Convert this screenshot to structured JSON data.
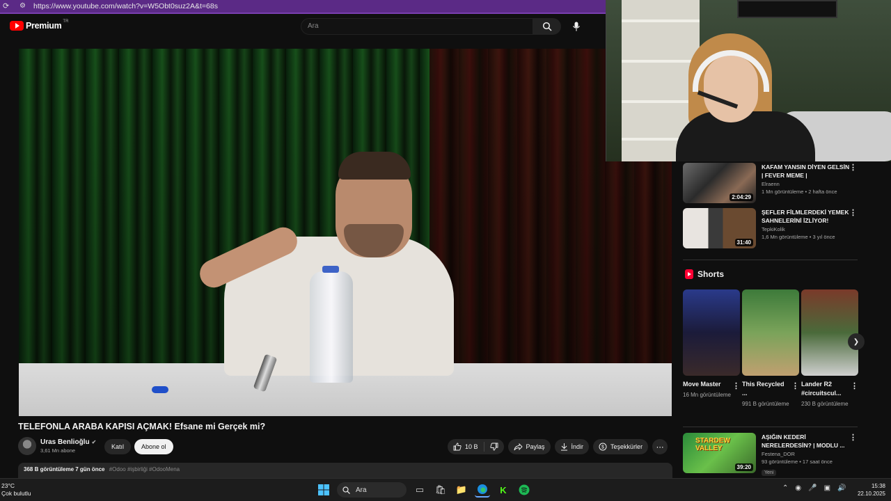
{
  "browser": {
    "url": "https://www.youtube.com/watch?v=W5Obt0suz2A&t=68s"
  },
  "header": {
    "logo_text": "Premium",
    "logo_region": "TR",
    "search_placeholder": "Ara"
  },
  "video": {
    "title": "TELEFONLA ARABA KAPISI AÇMAK! Efsane mi Gerçek mi?",
    "channel_name": "Uras Benlioğlu",
    "subscribers": "3,61 Mn abone",
    "join_label": "Katıl",
    "subscribe_label": "Abone ol",
    "likes": "10 B",
    "share_label": "Paylaş",
    "download_label": "İndir",
    "thanks_label": "Teşekkürler",
    "views": "368 B görüntüleme",
    "age": "7 gün önce",
    "tags": "#Odoo #işbirliği #OdooMena"
  },
  "recommendations": [
    {
      "title": "KAFAM YANSIN DİYEN GELSİN | FEVER MEME |",
      "channel": "Elraenn",
      "meta": "1 Mn görüntüleme • 2 hafta önce",
      "duration": "2:04:29"
    },
    {
      "title": "ŞEFLER FİLMLERDEKİ YEMEK SAHNELERİNİ İZLİYOR!",
      "channel": "TepkiKolik",
      "meta": "1,6 Mn görüntüleme • 3 yıl önce",
      "duration": "31:40"
    }
  ],
  "shorts": {
    "heading": "Shorts",
    "items": [
      {
        "title": "Move Master",
        "views": "16 Mn görüntüleme"
      },
      {
        "title": "This Recycled ...",
        "views": "991 B görüntüleme"
      },
      {
        "title": "Lander R2 #circuitscul...",
        "views": "230 B görüntüleme"
      }
    ]
  },
  "rec_bottom": {
    "title": "AŞIĞIN KEDERİ NERELERDESİN? | MODLU ...",
    "channel": "Festena_DOR",
    "meta": "93 görüntüleme • 17 saat önce",
    "duration": "39:20",
    "badge": "Yeni",
    "thumb_text": "STARDEW VALLEY"
  },
  "taskbar": {
    "temperature": "23°C",
    "weather": "Çok bulutlu",
    "search_label": "Ara",
    "time": "15:38",
    "date": "22.10.2025"
  },
  "colors": {
    "accent_red": "#ff0000",
    "browser_bar": "#5b2a86",
    "background": "#0f0f0f"
  }
}
